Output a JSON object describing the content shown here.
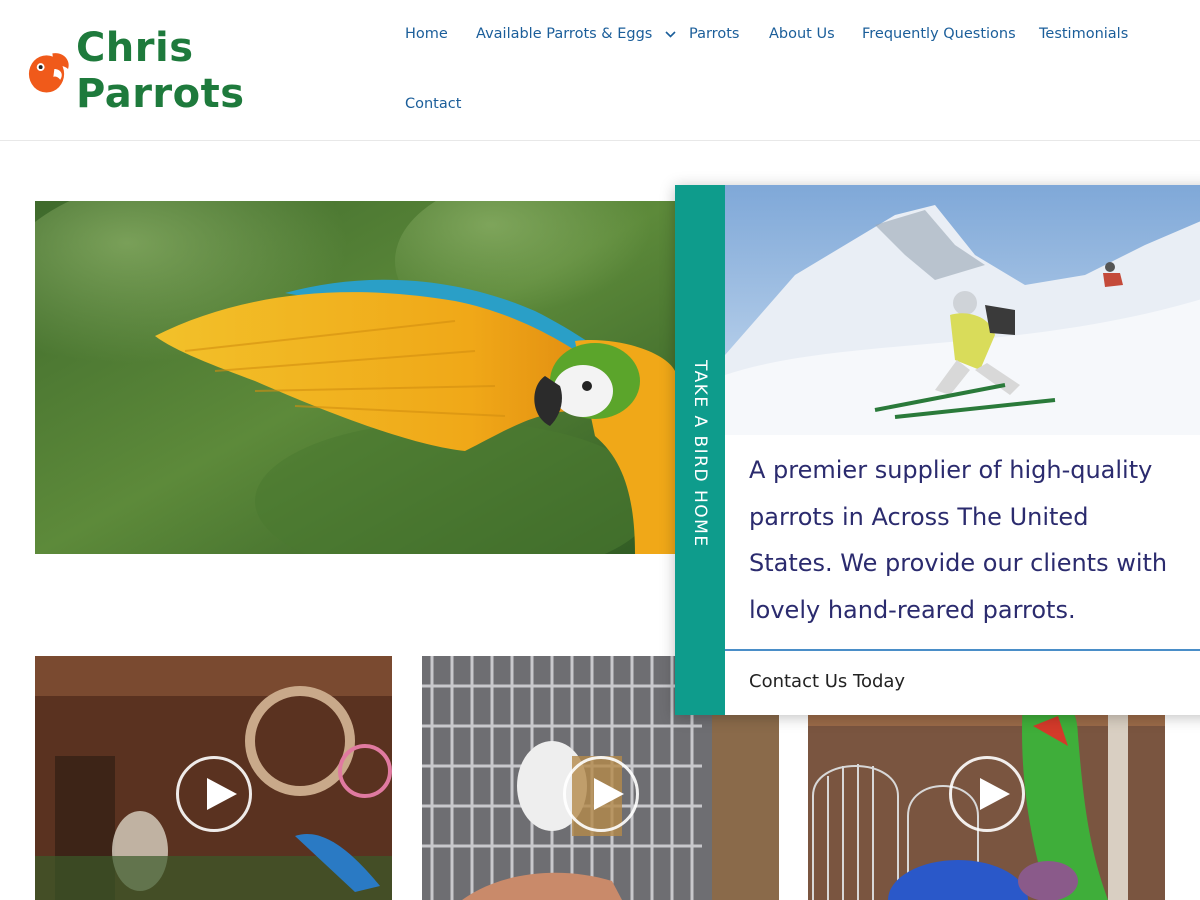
{
  "brand": {
    "name": "Chris Parrots"
  },
  "nav": {
    "items": [
      {
        "label": "Home"
      },
      {
        "label": "Available Parrots & Eggs"
      },
      {
        "label": "Parrots"
      },
      {
        "label": "About Us"
      },
      {
        "label": "Frequently Questions"
      },
      {
        "label": "Testimonials"
      },
      {
        "label": "Contact"
      }
    ]
  },
  "popup": {
    "tab_label": "TAKE A BIRD HOME",
    "message": "A premier supplier of high-quality parrots in Across The United States. We provide our clients with lovely hand-reared parrots.",
    "cta": "Contact Us Today"
  },
  "colors": {
    "brand_green": "#1e7a3c",
    "logo_orange": "#f05a1a",
    "nav_blue": "#1b5e9a",
    "tab_teal": "#0e9c8c",
    "popup_text": "#2b2b6e"
  },
  "icons": [
    "parrot-logo-icon",
    "chevron-down-icon",
    "play-icon"
  ]
}
